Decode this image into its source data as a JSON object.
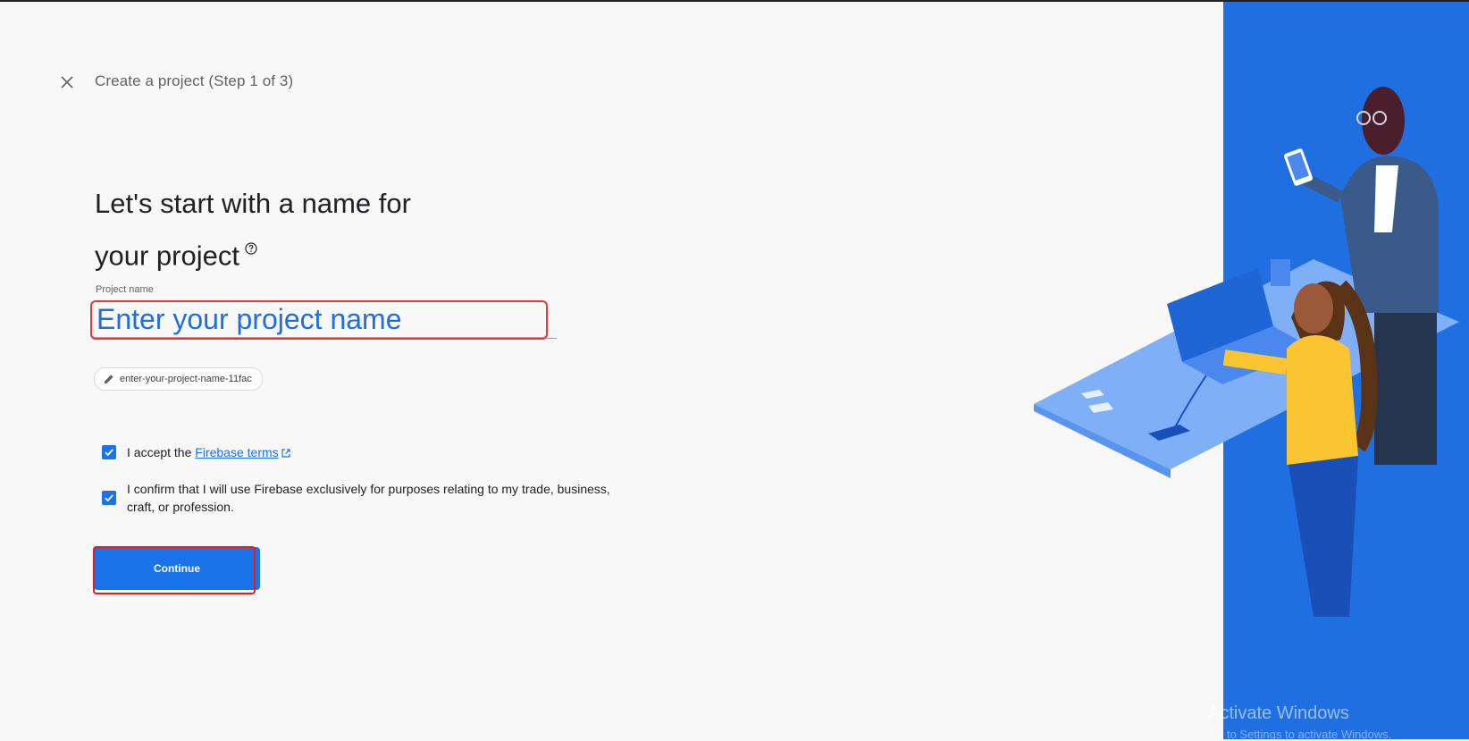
{
  "header": {
    "crumb": "Create a project (Step 1 of 3)"
  },
  "main": {
    "headline_line1": "Let's start with a name for",
    "headline_line2": "your project",
    "field_label": "Project name",
    "input_placeholder": "Enter your project name",
    "input_value": "",
    "project_id": "enter-your-project-name-11fac"
  },
  "terms": {
    "accept_prefix": "I accept the",
    "accept_link": "Firebase terms",
    "confirm_text": "I confirm that I will use Firebase exclusively for purposes relating to my trade, business, craft, or profession."
  },
  "actions": {
    "continue_label": "Continue"
  },
  "watermark": {
    "title": "Activate Windows",
    "subtitle": "Go to Settings to activate Windows."
  },
  "colors": {
    "accent": "#1a73e8",
    "panel": "#1f6fe0",
    "highlight": "#e51d1d"
  },
  "icons": [
    "close-icon",
    "help-circle-icon",
    "pencil-icon",
    "checkbox-checked-icon",
    "external-link-icon"
  ]
}
